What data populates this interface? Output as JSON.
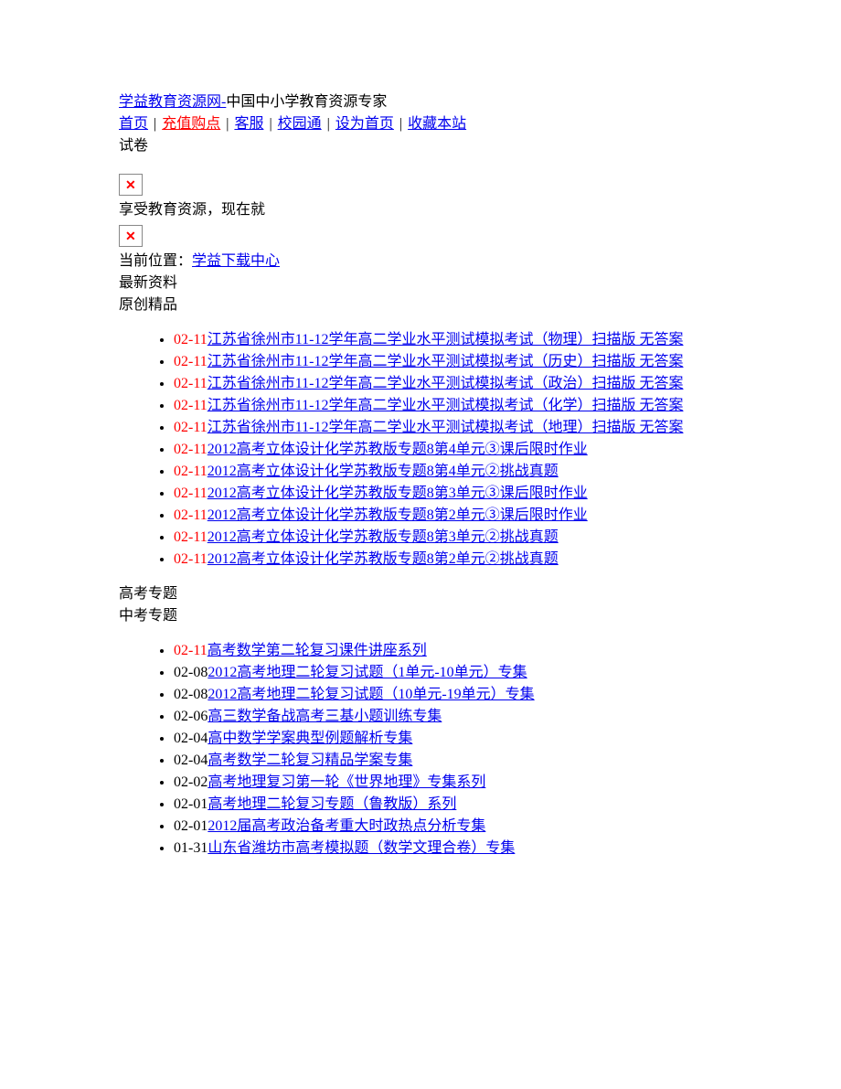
{
  "header": {
    "site_link": "学益教育资源网-",
    "site_tagline": "中国中小学教育资源专家",
    "nav": {
      "home": "首页",
      "recharge": "充值购点",
      "service": "客服",
      "campus": "校园通",
      "set_home": "设为首页",
      "favorite": "收藏本站"
    },
    "category": "试卷",
    "slogan": "享受教育资源，现在就",
    "breadcrumb_prefix": "当前位置：",
    "breadcrumb_link": "学益下载中心",
    "section_latest": "最新资料",
    "section_original": "原创精品"
  },
  "broken_icon": "✕",
  "list1": {
    "items": [
      {
        "date": "02-11",
        "text": "江苏省徐州市11-12学年高二学业水平测试模拟考试（物理）扫描版 无答案"
      },
      {
        "date": "02-11",
        "text": "江苏省徐州市11-12学年高二学业水平测试模拟考试（历史）扫描版 无答案"
      },
      {
        "date": "02-11",
        "text": "江苏省徐州市11-12学年高二学业水平测试模拟考试（政治）扫描版 无答案"
      },
      {
        "date": "02-11",
        "text": "江苏省徐州市11-12学年高二学业水平测试模拟考试（化学）扫描版 无答案"
      },
      {
        "date": "02-11",
        "text": "江苏省徐州市11-12学年高二学业水平测试模拟考试（地理）扫描版 无答案"
      },
      {
        "date": "02-11",
        "text": "2012高考立体设计化学苏教版专题8第4单元③课后限时作业"
      },
      {
        "date": "02-11",
        "text": "2012高考立体设计化学苏教版专题8第4单元②挑战真题"
      },
      {
        "date": "02-11",
        "text": "2012高考立体设计化学苏教版专题8第3单元③课后限时作业"
      },
      {
        "date": "02-11",
        "text": "2012高考立体设计化学苏教版专题8第2单元③课后限时作业"
      },
      {
        "date": "02-11",
        "text": "2012高考立体设计化学苏教版专题8第3单元②挑战真题"
      },
      {
        "date": "02-11",
        "text": "2012高考立体设计化学苏教版专题8第2单元②挑战真题"
      }
    ]
  },
  "section_gaokao": "高考专题",
  "section_zhongkao": "中考专题",
  "list2": {
    "items": [
      {
        "date": "02-11",
        "dateRed": true,
        "text": "高考数学第二轮复习课件讲座系列"
      },
      {
        "date": "02-08",
        "dateRed": false,
        "text": "2012高考地理二轮复习试题（1单元-10单元）专集"
      },
      {
        "date": "02-08",
        "dateRed": false,
        "text": "2012高考地理二轮复习试题（10单元-19单元）专集"
      },
      {
        "date": "02-06",
        "dateRed": false,
        "text": "高三数学备战高考三基小题训练专集"
      },
      {
        "date": "02-04",
        "dateRed": false,
        "text": "高中数学学案典型例题解析专集"
      },
      {
        "date": "02-04",
        "dateRed": false,
        "text": "高考数学二轮复习精品学案专集"
      },
      {
        "date": "02-02",
        "dateRed": false,
        "text": "高考地理复习第一轮《世界地理》专集系列"
      },
      {
        "date": "02-01",
        "dateRed": false,
        "text": "高考地理二轮复习专题（鲁教版）系列"
      },
      {
        "date": "02-01",
        "dateRed": false,
        "text": "2012届高考政治备考重大时政热点分析专集"
      },
      {
        "date": "01-31",
        "dateRed": false,
        "text": "山东省潍坊市高考模拟题（数学文理合卷）专集"
      }
    ]
  }
}
